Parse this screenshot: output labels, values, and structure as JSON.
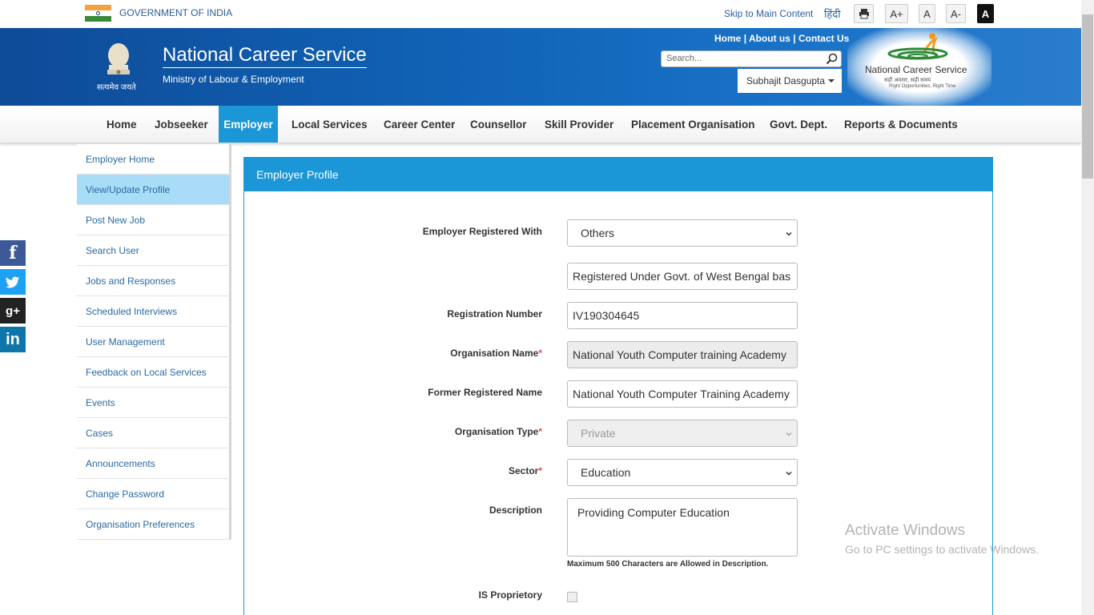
{
  "topbar": {
    "gov_label": "GOVERNMENT OF INDIA",
    "skip_label": "Skip to Main Content",
    "hindi_label": "हिंदी",
    "font_increase": "A+",
    "font_normal": "A",
    "font_decrease": "A-",
    "high_contrast": "A"
  },
  "header": {
    "emblem_caption": "सत्यमेव जयते",
    "title": "National Career Service",
    "subtitle": "Ministry of Labour & Employment",
    "links": [
      "Home",
      "About us",
      "Contact Us"
    ],
    "search_placeholder": "Search...",
    "user_name": "Subhajit Dasgupta",
    "logo_text": "National Career Service",
    "logo_sub": "सही अवसर, सही समय",
    "logo_sub2": "Right Opportunities, Right Time"
  },
  "nav": {
    "items": [
      "Home",
      "Jobseeker",
      "Employer",
      "Local Services",
      "Career Center",
      "Counsellor",
      "Skill Provider",
      "Placement Organisation",
      "Govt. Dept.",
      "Reports & Documents"
    ],
    "active": "Employer"
  },
  "sidebar": {
    "items": [
      "Employer Home",
      "View/Update Profile",
      "Post New Job",
      "Search User",
      "Jobs and Responses",
      "Scheduled Interviews",
      "User Management",
      "Feedback on Local Services",
      "Events",
      "Cases",
      "Announcements",
      "Change Password",
      "Organisation Preferences"
    ],
    "active": "View/Update Profile"
  },
  "form": {
    "heading": "Employer Profile",
    "registered_with_label": "Employer Registered With",
    "registered_with_value": "Others",
    "registered_other_value": "Registered Under Govt. of West Bengal bas",
    "reg_number_label": "Registration Number",
    "reg_number_value": "IV190304645",
    "org_name_label": "Organisation Name",
    "org_name_value": "National Youth Computer training Academy",
    "former_name_label": "Former Registered Name",
    "former_name_value": "National Youth Computer Training Academy",
    "org_type_label": "Organisation Type",
    "org_type_value": "Private",
    "sector_label": "Sector",
    "sector_value": "Education",
    "description_label": "Description",
    "description_value": "Providing Computer Education",
    "description_hint": "Maximum 500 Characters are Allowed in Description.",
    "proprietory_label": "IS Proprietory",
    "required_mark": "*"
  },
  "social": {
    "facebook": "f",
    "twitter": "t",
    "googleplus": "g+",
    "linkedin": "in"
  },
  "watermark": {
    "title": "Activate Windows",
    "subtitle": "Go to PC settings to activate Windows."
  },
  "colors": {
    "header_blue": "#1164b8",
    "accent_blue": "#1b96d6",
    "sidebar_active": "#a8dcf7",
    "link_blue": "#2c6aa0"
  }
}
